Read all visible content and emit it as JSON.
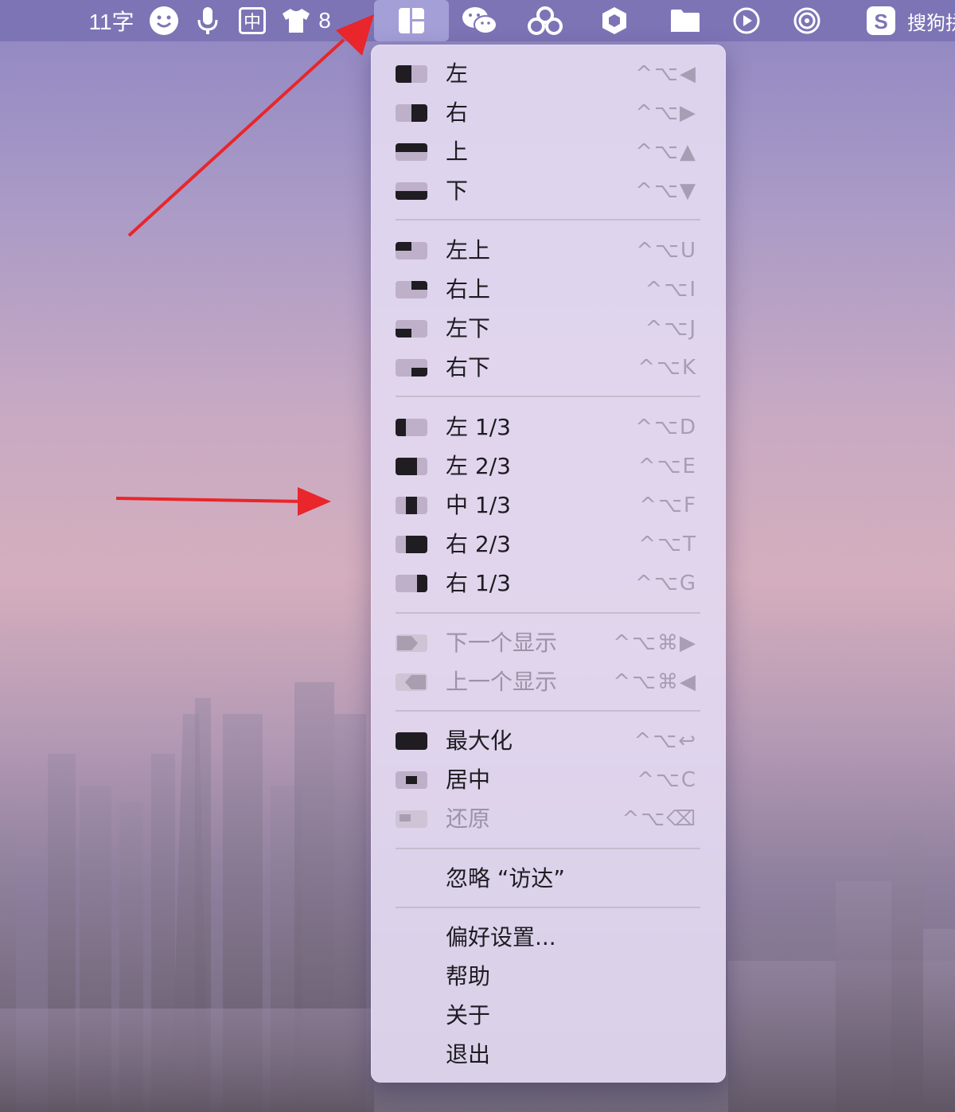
{
  "colors": {
    "menubar": "#7d74b6",
    "arrow": "#e8262b",
    "icon_fill": "#1f1c22"
  },
  "menubar": {
    "word_count": "11字",
    "input_method": "中",
    "badge_count": "8",
    "right_text": "搜狗拼",
    "icons": [
      "smiley-icon",
      "microphone-icon",
      "input-method-icon",
      "tshirt-icon",
      "rectangle-layout-icon",
      "wechat-icon",
      "baidu-cloud-icon",
      "hexagon-icon",
      "folder-icon",
      "play-icon",
      "airdrop-icon",
      "sogou-icon"
    ]
  },
  "menu": {
    "items": [
      {
        "label": "左",
        "shortcut": "^⌥◀"
      },
      {
        "label": "右",
        "shortcut": "^⌥▶"
      },
      {
        "label": "上",
        "shortcut": "^⌥▲"
      },
      {
        "label": "下",
        "shortcut": "^⌥▼"
      },
      {
        "label": "左上",
        "shortcut": "^⌥U"
      },
      {
        "label": "右上",
        "shortcut": "^⌥I"
      },
      {
        "label": "左下",
        "shortcut": "^⌥J"
      },
      {
        "label": "右下",
        "shortcut": "^⌥K"
      },
      {
        "label": "左 1/3",
        "shortcut": "^⌥D"
      },
      {
        "label": "左 2/3",
        "shortcut": "^⌥E"
      },
      {
        "label": "中 1/3",
        "shortcut": "^⌥F"
      },
      {
        "label": "右 2/3",
        "shortcut": "^⌥T"
      },
      {
        "label": "右 1/3",
        "shortcut": "^⌥G"
      },
      {
        "label": "下一个显示",
        "shortcut": "^⌥⌘▶"
      },
      {
        "label": "上一个显示",
        "shortcut": "^⌥⌘◀"
      },
      {
        "label": "最大化",
        "shortcut": "^⌥↩"
      },
      {
        "label": "居中",
        "shortcut": "^⌥C"
      },
      {
        "label": "还原",
        "shortcut": "^⌥⌫"
      },
      {
        "label": "忽略 “访达”"
      },
      {
        "label": "偏好设置..."
      },
      {
        "label": "帮助"
      },
      {
        "label": "关于"
      },
      {
        "label": "退出"
      }
    ]
  }
}
